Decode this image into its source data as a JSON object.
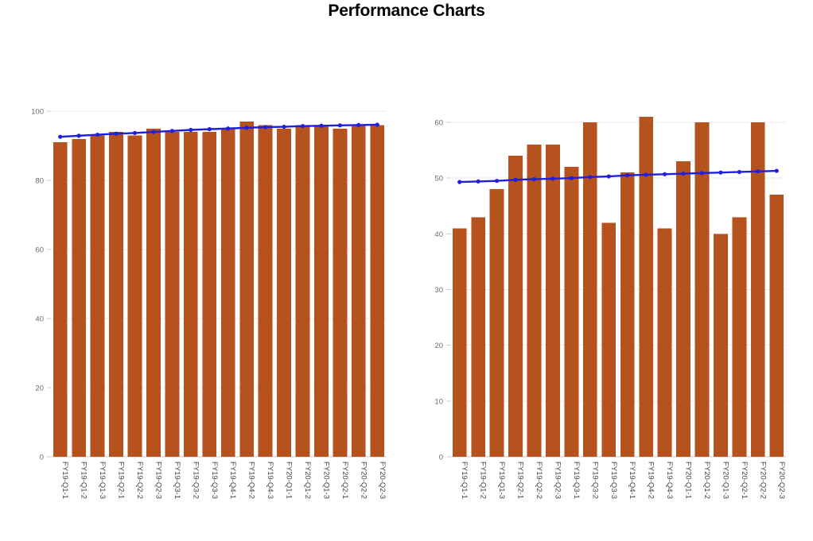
{
  "page": {
    "title": "Performance Charts",
    "background_color": "#ffffff"
  },
  "colors": {
    "bar": "#b5521e",
    "trend": "#1f1fdd",
    "trend_point": "#1f1fdd",
    "grid": "#eceaea",
    "axis": "#cfcfcf",
    "tick_text": "#6b6b6b",
    "title_text": "#000000"
  },
  "categories": [
    "FY19-Q1-1",
    "FY19-Q1-2",
    "FY19-Q1-3",
    "FY19-Q2-1",
    "FY19-Q2-2",
    "FY19-Q2-3",
    "FY19-Q3-1",
    "FY19-Q3-2",
    "FY19-Q3-3",
    "FY19-Q4-1",
    "FY19-Q4-2",
    "FY19-Q4-3",
    "FY20-Q1-1",
    "FY20-Q1-2",
    "FY20-Q1-3",
    "FY20-Q2-1",
    "FY20-Q2-2",
    "FY20-Q2-3"
  ],
  "chart_data": [
    {
      "id": "left",
      "type": "bar",
      "title": "",
      "xlabel": "",
      "ylabel": "",
      "ylim": [
        0,
        100
      ],
      "yticks": [
        0,
        20,
        40,
        60,
        80,
        100
      ],
      "grid": true,
      "legend": "none",
      "categories": [
        "FY19-Q1-1",
        "FY19-Q1-2",
        "FY19-Q1-3",
        "FY19-Q2-1",
        "FY19-Q2-2",
        "FY19-Q2-3",
        "FY19-Q3-1",
        "FY19-Q3-2",
        "FY19-Q3-3",
        "FY19-Q4-1",
        "FY19-Q4-2",
        "FY19-Q4-3",
        "FY20-Q1-1",
        "FY20-Q1-2",
        "FY20-Q1-3",
        "FY20-Q2-1",
        "FY20-Q2-2",
        "FY20-Q2-3"
      ],
      "series": [
        {
          "name": "value",
          "kind": "bar",
          "values": [
            91,
            92,
            93,
            94,
            93,
            95,
            94,
            94,
            94,
            95,
            97,
            96,
            95,
            96,
            96,
            95,
            96,
            96
          ]
        },
        {
          "name": "trend",
          "kind": "line",
          "values": [
            92.6,
            92.9,
            93.2,
            93.5,
            93.7,
            94.0,
            94.3,
            94.6,
            94.8,
            95.0,
            95.2,
            95.4,
            95.5,
            95.7,
            95.8,
            95.9,
            96.0,
            96.1
          ]
        }
      ]
    },
    {
      "id": "right",
      "type": "bar",
      "title": "",
      "xlabel": "",
      "ylabel": "",
      "ylim": [
        0,
        62
      ],
      "yticks": [
        0,
        10,
        20,
        30,
        40,
        50,
        60
      ],
      "grid": true,
      "legend": "none",
      "categories": [
        "FY19-Q1-1",
        "FY19-Q1-2",
        "FY19-Q1-3",
        "FY19-Q2-1",
        "FY19-Q2-2",
        "FY19-Q2-3",
        "FY19-Q3-1",
        "FY19-Q3-2",
        "FY19-Q3-3",
        "FY19-Q4-1",
        "FY19-Q4-2",
        "FY19-Q4-3",
        "FY20-Q1-1",
        "FY20-Q1-2",
        "FY20-Q1-3",
        "FY20-Q2-1",
        "FY20-Q2-2",
        "FY20-Q2-3"
      ],
      "series": [
        {
          "name": "value",
          "kind": "bar",
          "values": [
            41,
            43,
            48,
            54,
            56,
            56,
            52,
            60,
            42,
            51,
            61,
            41,
            53,
            60,
            40,
            43,
            60,
            47
          ]
        },
        {
          "name": "trend",
          "kind": "line",
          "values": [
            49.3,
            49.4,
            49.5,
            49.7,
            49.8,
            49.9,
            50.0,
            50.2,
            50.3,
            50.5,
            50.6,
            50.7,
            50.8,
            50.9,
            51.0,
            51.1,
            51.2,
            51.3
          ]
        }
      ]
    }
  ]
}
